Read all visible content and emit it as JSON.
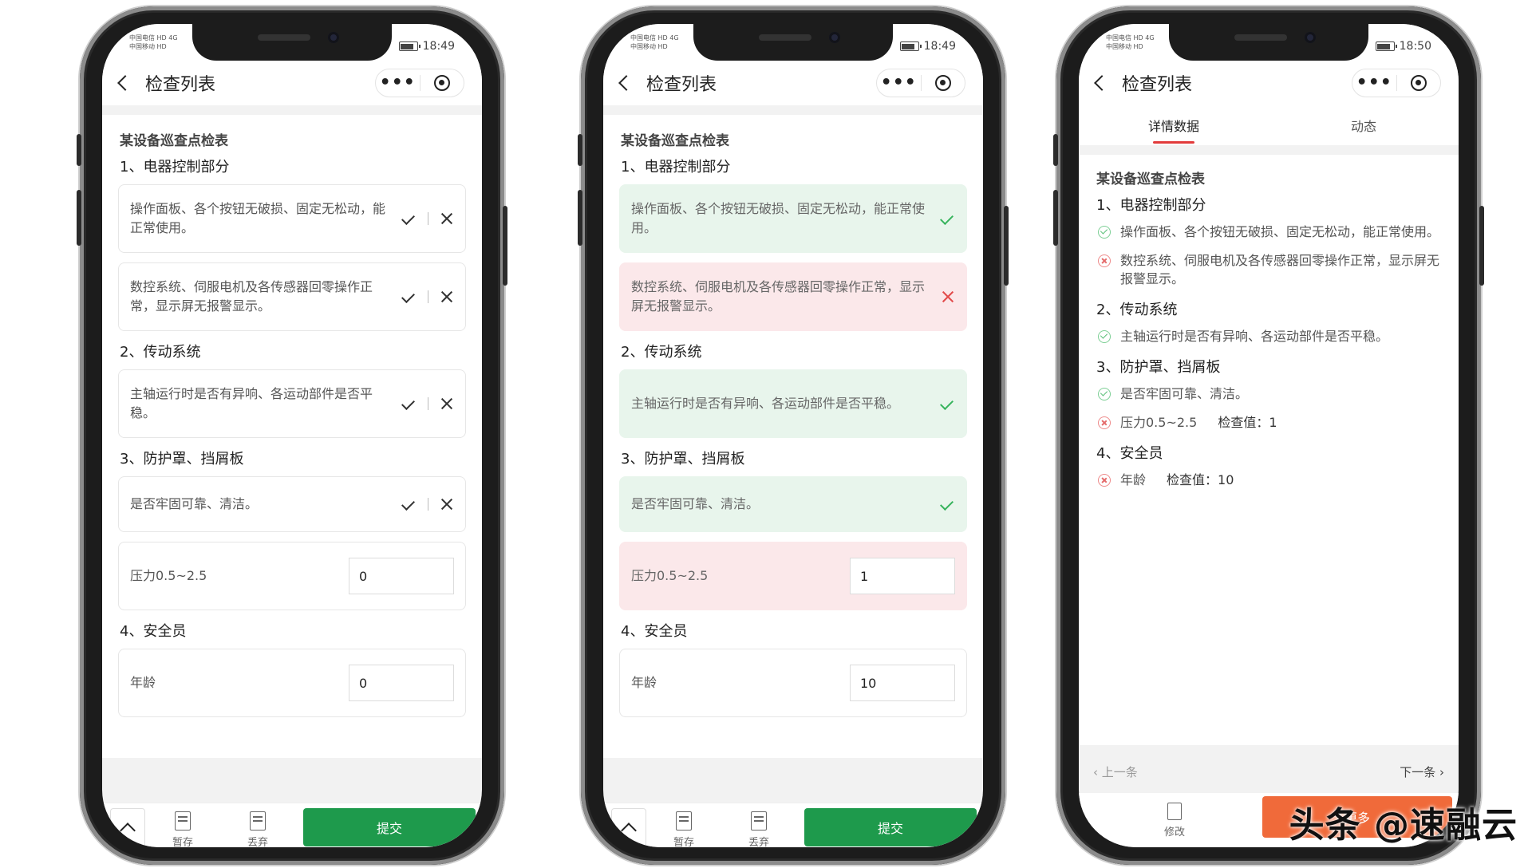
{
  "screens": [
    {
      "status": {
        "carrier_line1": "中国电信 HD 4G",
        "carrier_line2": "中国移动 HD",
        "time": "18:49"
      },
      "nav": {
        "title": "检查列表",
        "more": "•••"
      },
      "form_title": "某设备巡查点检表",
      "sections": {
        "s1": "1、电器控制部分",
        "s2": "2、传动系统",
        "s3": "3、防护罩、挡屑板",
        "s4": "4、安全员"
      },
      "items": {
        "i1": "操作面板、各个按钮无破损、固定无松动，能正常使用。",
        "i2": "数控系统、伺服电机及各传感器回零操作正常，显示屏无报警显示。",
        "i3": "主轴运行时是否有异响、各运动部件是否平稳。",
        "i4": "是否牢固可靠、清洁。",
        "i5_label": "压力0.5~2.5",
        "i5_value": "0",
        "i6_label": "年龄",
        "i6_value": "0"
      },
      "bottom": {
        "save": "暂存",
        "discard": "丢弃",
        "submit": "提交"
      }
    },
    {
      "status": {
        "carrier_line1": "中国电信 HD 4G",
        "carrier_line2": "中国移动 HD",
        "time": "18:49"
      },
      "nav": {
        "title": "检查列表",
        "more": "•••"
      },
      "form_title": "某设备巡查点检表",
      "sections": {
        "s1": "1、电器控制部分",
        "s2": "2、传动系统",
        "s3": "3、防护罩、挡屑板",
        "s4": "4、安全员"
      },
      "items": {
        "i1": "操作面板、各个按钮无破损、固定无松动，能正常使用。",
        "i2": "数控系统、伺服电机及各传感器回零操作正常，显示屏无报警显示。",
        "i3": "主轴运行时是否有异响、各运动部件是否平稳。",
        "i4": "是否牢固可靠、清洁。",
        "i5_label": "压力0.5~2.5",
        "i5_value": "1",
        "i6_label": "年龄",
        "i6_value": "10"
      },
      "bottom": {
        "save": "暂存",
        "discard": "丢弃",
        "submit": "提交"
      }
    },
    {
      "status": {
        "carrier_line1": "中国电信 HD 4G",
        "carrier_line2": "中国移动 HD",
        "time": "18:50"
      },
      "nav": {
        "title": "检查列表",
        "more": "•••"
      },
      "tabs": {
        "detail": "详情数据",
        "activity": "动态"
      },
      "form_title": "某设备巡查点检表",
      "sections": {
        "s1": "1、电器控制部分",
        "s2": "2、传动系统",
        "s3": "3、防护罩、挡屑板",
        "s4": "4、安全员"
      },
      "rows": {
        "r1": "操作面板、各个按钮无破损、固定无松动，能正常使用。",
        "r2": "数控系统、伺服电机及各传感器回零操作正常，显示屏无报警显示。",
        "r3": "主轴运行时是否有异响、各运动部件是否平稳。",
        "r4": "是否牢固可靠、清洁。",
        "r5_label": "压力0.5~2.5",
        "r5_value": "检查值：1",
        "r6_label": "年龄",
        "r6_value": "检查值：10"
      },
      "pager": {
        "prev": "‹ 上一条",
        "next": "下一条 ›"
      },
      "bottom": {
        "edit": "修改",
        "more": "更多"
      }
    }
  ],
  "watermark": "头条 @速融云",
  "colors": {
    "ok_bg": "#e8f5ec",
    "bad_bg": "#fbe8ea",
    "submit": "#1e9a4c",
    "more": "#f06a3a",
    "tab_accent": "#e23b3b"
  }
}
